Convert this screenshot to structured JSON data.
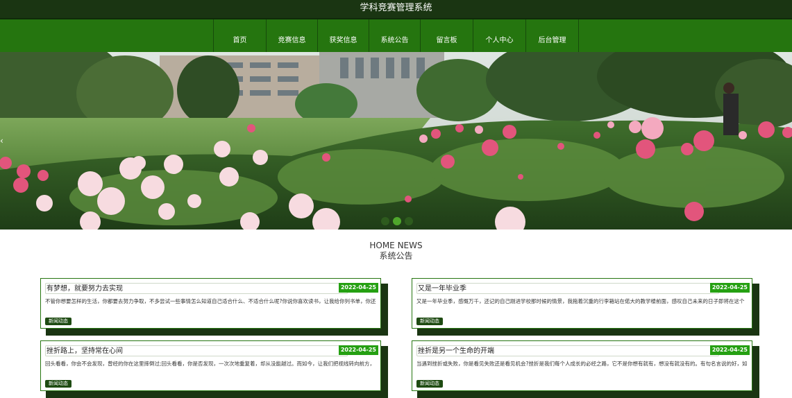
{
  "app": {
    "title": "学科竞赛管理系统"
  },
  "nav": {
    "items": [
      {
        "label": "首页"
      },
      {
        "label": "竞赛信息"
      },
      {
        "label": "获奖信息"
      },
      {
        "label": "系统公告"
      },
      {
        "label": "留言板"
      },
      {
        "label": "个人中心"
      },
      {
        "label": "后台管理"
      }
    ]
  },
  "banner": {
    "prev_arrow": "‹",
    "slides_count": 3,
    "active_slide": 2
  },
  "news": {
    "heading_en": "HOME NEWS",
    "heading_cn": "系统公告",
    "cards": [
      {
        "title": "有梦想，就要努力去实现",
        "date": "2022-04-25",
        "excerpt": "不管你想要怎样的生活，你都要去努力争取，不多尝试一些事情怎么知道自己适合什么、不适合什么呢?你说你喜欢读书，让我给你列书单，你还",
        "tag": "新闻动态"
      },
      {
        "title": "又是一年毕业季",
        "date": "2022-04-25",
        "excerpt": "又是一年毕业季，感慨万千，还记的自己刚进学校那时候的情景，我拖着沉重的行李箱站在偌大的教学楼前面，感叹自己未来的日子即将在这个",
        "tag": "新闻动态"
      },
      {
        "title": "挫折路上，坚持常在心间",
        "date": "2022-04-25",
        "excerpt": "回头看看，你会不会发现，曾经的你在这里摔倒过;回头看看，你是否发现，一次次地重复着，却从没能越过。而如今，让我们把视线转向前方，",
        "tag": "新闻动态"
      },
      {
        "title": "挫折是另一个生命的开端",
        "date": "2022-04-25",
        "excerpt": "当遇到挫折或失败，你是看见失败还是看见机会?挫折是我们每个人成长的必经之路，它不是你想有就有，想没有就没有的。有句名言说的好，如",
        "tag": "新闻动态"
      }
    ]
  },
  "colors": {
    "header_dark": "#1a3512",
    "nav_green": "#25750f",
    "date_green": "#25a012",
    "tag_green": "#1e4b12"
  }
}
